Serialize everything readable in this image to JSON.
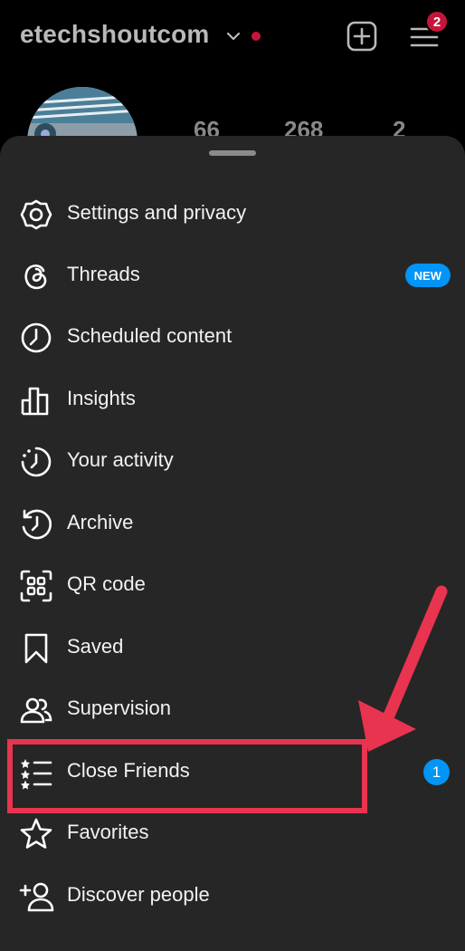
{
  "header": {
    "username": "etechshoutcom",
    "notification_count": "2"
  },
  "profile": {
    "stats": [
      "66",
      "268",
      "2"
    ]
  },
  "menu": {
    "items": [
      {
        "label": "Settings and privacy",
        "icon": "settings-icon"
      },
      {
        "label": "Threads",
        "icon": "threads-icon",
        "badge": "NEW"
      },
      {
        "label": "Scheduled content",
        "icon": "clock-icon"
      },
      {
        "label": "Insights",
        "icon": "insights-bar-icon"
      },
      {
        "label": "Your activity",
        "icon": "activity-icon"
      },
      {
        "label": "Archive",
        "icon": "archive-icon"
      },
      {
        "label": "QR code",
        "icon": "qr-code-icon"
      },
      {
        "label": "Saved",
        "icon": "bookmark-icon"
      },
      {
        "label": "Supervision",
        "icon": "supervision-icon"
      },
      {
        "label": "Close Friends",
        "icon": "close-friends-icon",
        "count": "1"
      },
      {
        "label": "Favorites",
        "icon": "star-icon"
      },
      {
        "label": "Discover people",
        "icon": "add-person-icon"
      }
    ]
  },
  "colors": {
    "accent": "#0095f6",
    "highlight": "#e8344f",
    "sheet_bg": "#262626",
    "alert": "#c4163a"
  }
}
